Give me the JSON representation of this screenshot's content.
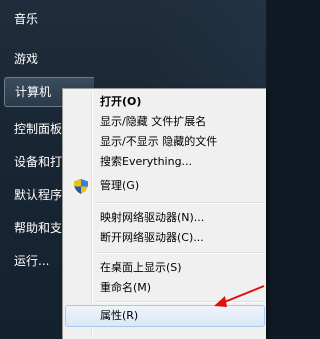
{
  "start_menu": {
    "items": [
      {
        "label": "音乐"
      },
      {
        "label": "游戏"
      },
      {
        "label": "计算机"
      },
      {
        "label": "控制面板"
      },
      {
        "label": "设备和打印机"
      },
      {
        "label": "默认程序"
      },
      {
        "label": "帮助和支持"
      },
      {
        "label": "运行..."
      }
    ]
  },
  "context_menu": {
    "items": [
      {
        "label": "打开(O)"
      },
      {
        "label": "显示/隐藏 文件扩展名"
      },
      {
        "label": "显示/不显示 隐藏的文件"
      },
      {
        "label": "搜索Everything..."
      },
      {
        "label": "管理(G)",
        "icon": "uac-shield-icon"
      },
      {
        "label": "映射网络驱动器(N)..."
      },
      {
        "label": "断开网络驱动器(C)..."
      },
      {
        "label": "在桌面上显示(S)"
      },
      {
        "label": "重命名(M)"
      },
      {
        "label": "属性(R)"
      }
    ]
  },
  "colors": {
    "annotation_arrow": "#e01010",
    "hover_border": "#a8c8ef"
  }
}
